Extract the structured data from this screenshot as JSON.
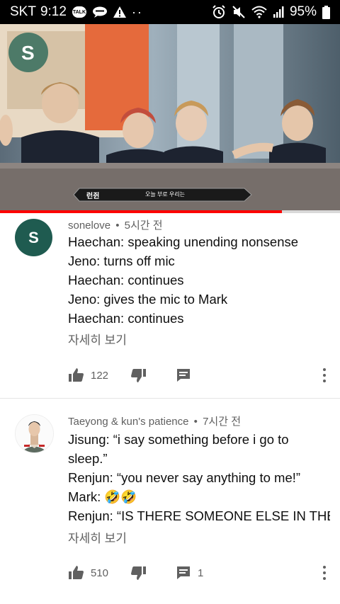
{
  "status_bar": {
    "carrier": "SKT",
    "time": "9:12",
    "talk_badge": "TALK",
    "battery": "95%",
    "icons": [
      "talk-icon",
      "chat-bubble-icon",
      "warning-icon",
      "more-notifications-icon",
      "alarm-icon",
      "mute-icon",
      "wifi-icon",
      "signal-icon",
      "battery-icon"
    ]
  },
  "video": {
    "caption_name": "런쥔",
    "caption_text": "오늘 부로 우리는",
    "progress": 0.83
  },
  "comments": [
    {
      "avatar_letter": "S",
      "avatar_color": "#1f5b50",
      "author": "sonelove",
      "time": "5시간 전",
      "lines": [
        "Haechan: speaking unending nonsense",
        "Jeno: turns off mic",
        "Haechan: continues",
        "Jeno: gives the mic to Mark",
        "Haechan: continues"
      ],
      "read_more": "자세히 보기",
      "likes": "122",
      "replies": ""
    },
    {
      "author": "Taeyong & kun's patience",
      "time": "7시간 전",
      "lines": [
        "Jisung: “i say something before i go to",
        "sleep.”",
        "Renjun: “you never say anything to me!”",
        "Mark: 🤣🤣",
        "Renjun: “IS THERE SOMEONE ELSE IN THE"
      ],
      "read_more": "자세히 보기",
      "likes": "510",
      "replies": "1"
    }
  ],
  "meta_separator": "•"
}
